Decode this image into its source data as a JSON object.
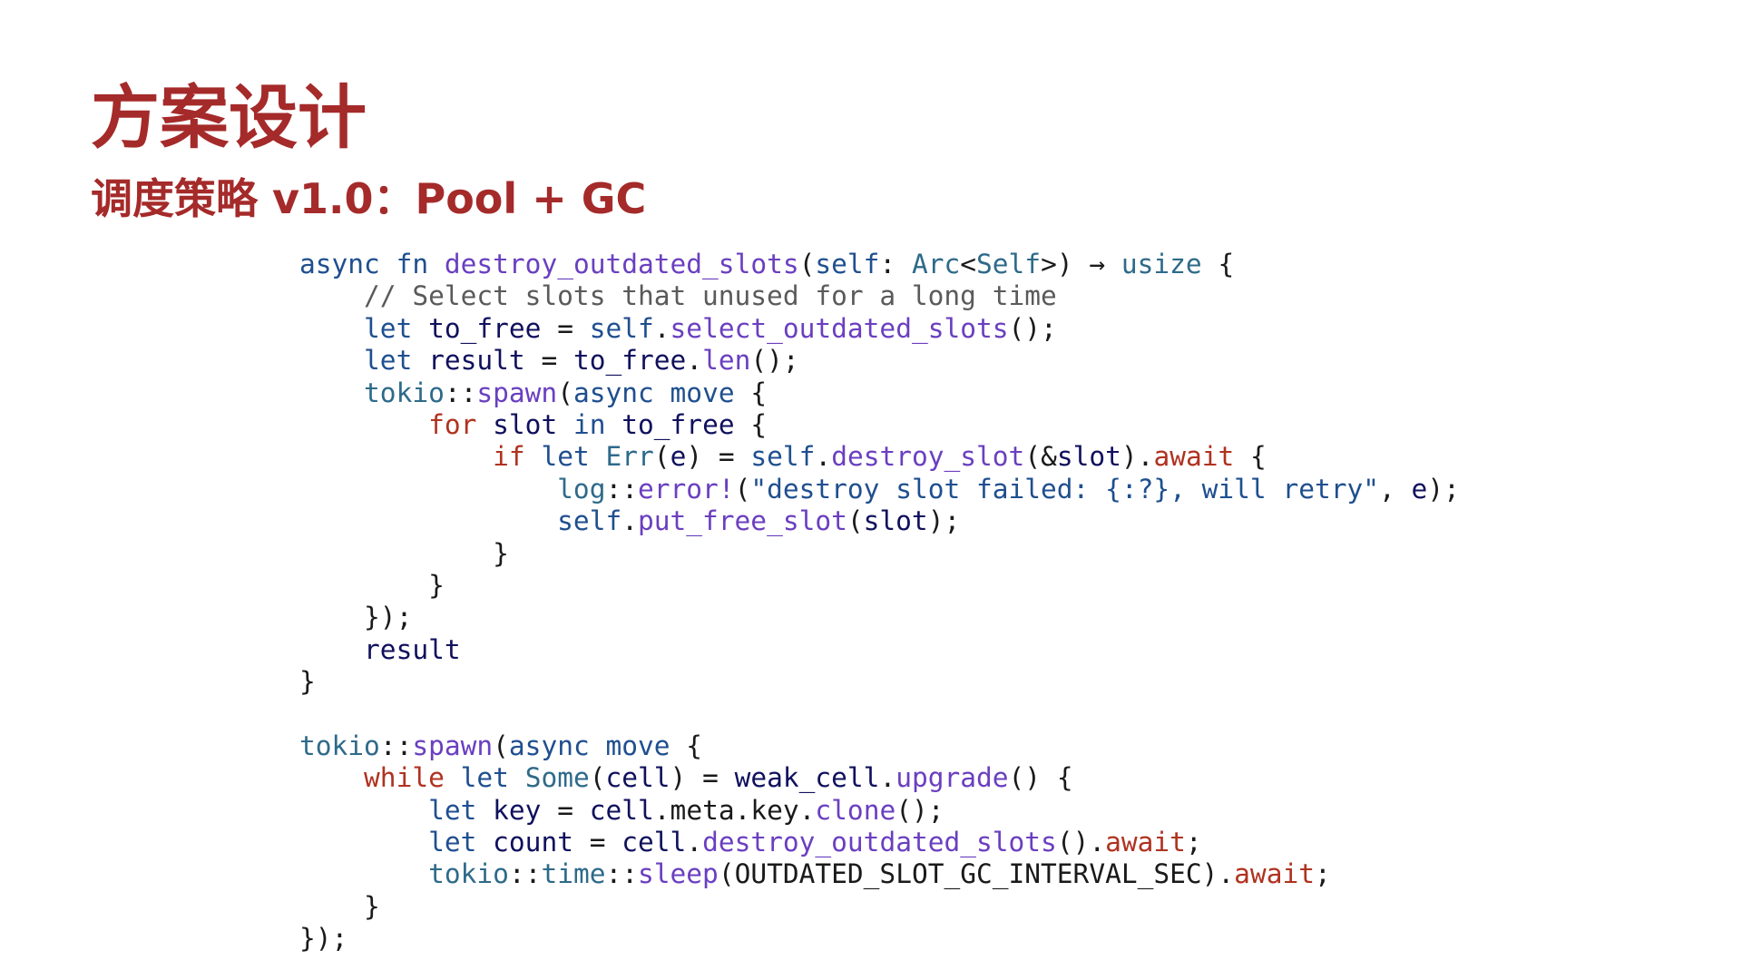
{
  "slide": {
    "title": "方案设计",
    "subtitle": "调度策略 v1.0：Pool + GC"
  },
  "colors": {
    "heading": "#a52a2a",
    "keyword": "#1f4f8f",
    "control": "#b03220",
    "function": "#6a3fc0",
    "variable": "#10105e",
    "type": "#2e6a8a",
    "comment": "#5a5a5a",
    "plain": "#1a1a1a"
  },
  "code": {
    "language": "rust",
    "lines": [
      [
        [
          "kw",
          "async"
        ],
        [
          "sp",
          " "
        ],
        [
          "kw",
          "fn"
        ],
        [
          "sp",
          " "
        ],
        [
          "fn",
          "destroy_outdated_slots"
        ],
        [
          "pn",
          "("
        ],
        [
          "kw",
          "self"
        ],
        [
          "pn",
          ": "
        ],
        [
          "ty",
          "Arc"
        ],
        [
          "pn",
          "<"
        ],
        [
          "ty",
          "Self"
        ],
        [
          "pn",
          ">) → "
        ],
        [
          "ty",
          "usize"
        ],
        [
          "pn",
          " {"
        ]
      ],
      [
        [
          "sp",
          "    "
        ],
        [
          "cm",
          "// Select slots that unused for a long time"
        ]
      ],
      [
        [
          "sp",
          "    "
        ],
        [
          "kw",
          "let"
        ],
        [
          "sp",
          " "
        ],
        [
          "var",
          "to_free"
        ],
        [
          "pn",
          " = "
        ],
        [
          "kw",
          "self"
        ],
        [
          "pn",
          "."
        ],
        [
          "fn",
          "select_outdated_slots"
        ],
        [
          "pn",
          "();"
        ]
      ],
      [
        [
          "sp",
          "    "
        ],
        [
          "kw",
          "let"
        ],
        [
          "sp",
          " "
        ],
        [
          "var",
          "result"
        ],
        [
          "pn",
          " = "
        ],
        [
          "var",
          "to_free"
        ],
        [
          "pn",
          "."
        ],
        [
          "fn",
          "len"
        ],
        [
          "pn",
          "();"
        ]
      ],
      [
        [
          "sp",
          "    "
        ],
        [
          "ns",
          "tokio"
        ],
        [
          "pn",
          "::"
        ],
        [
          "fn",
          "spawn"
        ],
        [
          "pn",
          "("
        ],
        [
          "kw",
          "async"
        ],
        [
          "sp",
          " "
        ],
        [
          "kw",
          "move"
        ],
        [
          "pn",
          " {"
        ]
      ],
      [
        [
          "sp",
          "        "
        ],
        [
          "ctl",
          "for"
        ],
        [
          "sp",
          " "
        ],
        [
          "var",
          "slot"
        ],
        [
          "sp",
          " "
        ],
        [
          "kw",
          "in"
        ],
        [
          "sp",
          " "
        ],
        [
          "var",
          "to_free"
        ],
        [
          "pn",
          " {"
        ]
      ],
      [
        [
          "sp",
          "            "
        ],
        [
          "ctl",
          "if"
        ],
        [
          "sp",
          " "
        ],
        [
          "kw",
          "let"
        ],
        [
          "sp",
          " "
        ],
        [
          "ty",
          "Err"
        ],
        [
          "pn",
          "("
        ],
        [
          "var",
          "e"
        ],
        [
          "pn",
          ") = "
        ],
        [
          "kw",
          "self"
        ],
        [
          "pn",
          "."
        ],
        [
          "fn",
          "destroy_slot"
        ],
        [
          "pn",
          "(&"
        ],
        [
          "var",
          "slot"
        ],
        [
          "pn",
          ")."
        ],
        [
          "aw",
          "await"
        ],
        [
          "pn",
          " {"
        ]
      ],
      [
        [
          "sp",
          "                "
        ],
        [
          "ns",
          "log"
        ],
        [
          "pn",
          "::"
        ],
        [
          "mac",
          "error!"
        ],
        [
          "pn",
          "("
        ],
        [
          "str",
          "\"destroy slot failed: {:?}, will retry\""
        ],
        [
          "pn",
          ", "
        ],
        [
          "var",
          "e"
        ],
        [
          "pn",
          ");"
        ]
      ],
      [
        [
          "sp",
          "                "
        ],
        [
          "kw",
          "self"
        ],
        [
          "pn",
          "."
        ],
        [
          "fn",
          "put_free_slot"
        ],
        [
          "pn",
          "("
        ],
        [
          "var",
          "slot"
        ],
        [
          "pn",
          ");"
        ]
      ],
      [
        [
          "sp",
          "            "
        ],
        [
          "pn",
          "}"
        ]
      ],
      [
        [
          "sp",
          "        "
        ],
        [
          "pn",
          "}"
        ]
      ],
      [
        [
          "sp",
          "    "
        ],
        [
          "pn",
          "});"
        ]
      ],
      [
        [
          "sp",
          "    "
        ],
        [
          "var",
          "result"
        ]
      ],
      [
        [
          "pn",
          "}"
        ]
      ],
      [
        [
          "sp",
          " "
        ]
      ],
      [
        [
          "ns",
          "tokio"
        ],
        [
          "pn",
          "::"
        ],
        [
          "fn",
          "spawn"
        ],
        [
          "pn",
          "("
        ],
        [
          "kw",
          "async"
        ],
        [
          "sp",
          " "
        ],
        [
          "kw",
          "move"
        ],
        [
          "pn",
          " {"
        ]
      ],
      [
        [
          "sp",
          "    "
        ],
        [
          "ctl",
          "while"
        ],
        [
          "sp",
          " "
        ],
        [
          "kw",
          "let"
        ],
        [
          "sp",
          " "
        ],
        [
          "ty",
          "Some"
        ],
        [
          "pn",
          "("
        ],
        [
          "var",
          "cell"
        ],
        [
          "pn",
          ") = "
        ],
        [
          "var",
          "weak_cell"
        ],
        [
          "pn",
          "."
        ],
        [
          "fn",
          "upgrade"
        ],
        [
          "pn",
          "() {"
        ]
      ],
      [
        [
          "sp",
          "        "
        ],
        [
          "kw",
          "let"
        ],
        [
          "sp",
          " "
        ],
        [
          "var",
          "key"
        ],
        [
          "pn",
          " = "
        ],
        [
          "var",
          "cell"
        ],
        [
          "pn",
          ".meta.key."
        ],
        [
          "fn",
          "clone"
        ],
        [
          "pn",
          "();"
        ]
      ],
      [
        [
          "sp",
          "        "
        ],
        [
          "kw",
          "let"
        ],
        [
          "sp",
          " "
        ],
        [
          "var",
          "count"
        ],
        [
          "pn",
          " = "
        ],
        [
          "var",
          "cell"
        ],
        [
          "pn",
          "."
        ],
        [
          "fn",
          "destroy_outdated_slots"
        ],
        [
          "pn",
          "()."
        ],
        [
          "aw",
          "await"
        ],
        [
          "pn",
          ";"
        ]
      ],
      [
        [
          "sp",
          "        "
        ],
        [
          "ns",
          "tokio"
        ],
        [
          "pn",
          "::"
        ],
        [
          "ns",
          "time"
        ],
        [
          "pn",
          "::"
        ],
        [
          "fn",
          "sleep"
        ],
        [
          "pn",
          "(OUTDATED_SLOT_GC_INTERVAL_SEC)."
        ],
        [
          "aw",
          "await"
        ],
        [
          "pn",
          ";"
        ]
      ],
      [
        [
          "sp",
          "    "
        ],
        [
          "pn",
          "}"
        ]
      ],
      [
        [
          "pn",
          "});"
        ]
      ]
    ]
  }
}
